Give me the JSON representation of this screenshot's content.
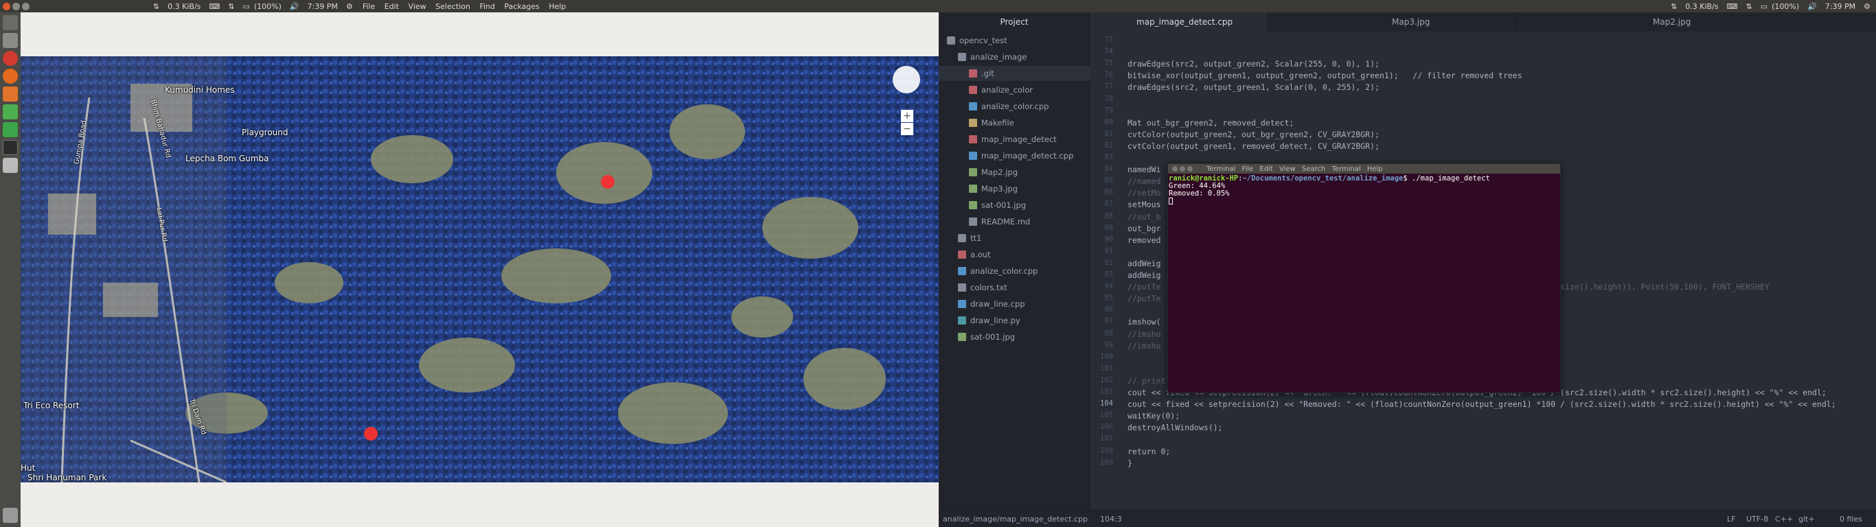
{
  "topbar_left": {
    "network": "0.3 KiB/s",
    "battery": "(100%)",
    "clock": "7:39 PM",
    "menus": [
      "File",
      "Edit",
      "View",
      "Selection",
      "Find",
      "Packages",
      "Help"
    ]
  },
  "topbar_right": {
    "network": "0.3 KiB/s",
    "battery": "(100%)",
    "clock": "7:39 PM"
  },
  "map": {
    "labels": [
      "Kumudini Homes",
      "Playground",
      "Lepcha Bom Gumba",
      "Tri Eco Resort",
      "Hut",
      "Shri Hanuman Park"
    ],
    "roads": [
      "Gumpa Road",
      "Bhim Bahadur Rd",
      "Lal Pur Rd",
      "Tri Dam Rd"
    ]
  },
  "project": {
    "title": "Project",
    "items": [
      {
        "label": "opencv_test",
        "type": "folder"
      },
      {
        "label": "analize_image",
        "type": "folder"
      },
      {
        "label": ".git",
        "type": "git"
      },
      {
        "label": "analize_color",
        "type": "bin"
      },
      {
        "label": "analize_color.cpp",
        "type": "cpp"
      },
      {
        "label": "Makefile",
        "type": "make"
      },
      {
        "label": "map_image_detect",
        "type": "bin"
      },
      {
        "label": "map_image_detect.cpp",
        "type": "cpp"
      },
      {
        "label": "Map2.jpg",
        "type": "img"
      },
      {
        "label": "Map3.jpg",
        "type": "img"
      },
      {
        "label": "sat-001.jpg",
        "type": "img"
      },
      {
        "label": "README.md",
        "type": "md"
      },
      {
        "label": "tt1",
        "type": "folder"
      },
      {
        "label": "a.out",
        "type": "bin"
      },
      {
        "label": "analize_color.cpp",
        "type": "cpp"
      },
      {
        "label": "colors.txt",
        "type": "txt"
      },
      {
        "label": "draw_line.cpp",
        "type": "cpp"
      },
      {
        "label": "draw_line.py",
        "type": "py"
      },
      {
        "label": "sat-001.jpg",
        "type": "img"
      }
    ]
  },
  "tabs": [
    "map_image_detect.cpp",
    "Map3.jpg",
    "Map2.jpg"
  ],
  "line_numbers": [
    "73",
    "74",
    "75",
    "76",
    "77",
    "78",
    "79",
    "80",
    "81",
    "82",
    "83",
    "84",
    "85",
    "86",
    "87",
    "88",
    "89",
    "90",
    "91",
    "92",
    "93",
    "94",
    "95",
    "96",
    "97",
    "98",
    "99",
    "100",
    "101",
    "102",
    "103",
    "104",
    "105",
    "106",
    "107",
    "108",
    "109"
  ],
  "code": [
    "",
    "",
    "drawEdges(src2, output_green2, Scalar(255, 0, 0), 1);",
    "bitwise_xor(output_green1, output_green2, output_green1);   // filter removed trees",
    "drawEdges(src2, output_green1, Scalar(0, 0, 255), 2);",
    "",
    "",
    "Mat out_bgr_green2, removed_detect;",
    "cvtColor(output_green2, out_bgr_green2, CV_GRAY2BGR);",
    "cvtColor(output_green1, removed_detect, CV_GRAY2BGR);",
    "",
    "namedWi",
    "//named",
    "//setMo",
    "setMous",
    "//out_b",
    "out_bgr",
    "removed",
    "",
    "addWeig",
    "addWeig",
    "//putTe                                                                     ).width * src2.size().height)), Point(50,100), FONT_HERSHEY",
    "//putTe                                                                     4);",
    "",
    "imshow(",
    "//imsho",
    "//imsho",
    "",
    "",
    "// print the percentage value",
    "cout << fixed << setprecision(2) << \"Green: \" << (float)countNonZero(output_green2) *100 / (src2.size().width * src2.size().height) << \"%\" << endl;",
    "cout << fixed << setprecision(2) << \"Removed: \" << (float)countNonZero(output_green1) *100 / (src2.size().width * src2.size().height) << \"%\" << endl;",
    "waitKey(0);",
    "destroyAllWindows();",
    "",
    "return 0;",
    "}"
  ],
  "terminal": {
    "title": "ranick@ranick-HP: ~/Documents/opencv_test/analize_image",
    "menus": [
      "Terminal",
      "File",
      "Edit",
      "View",
      "Search",
      "Terminal",
      "Help"
    ],
    "lines": [
      "ranick@ranick-HP:~/Documents/opencv_test/analize_image$ ./map_image_detect",
      "Green: 44.64%",
      "Removed: 0.05%",
      ""
    ]
  },
  "status": {
    "path": "analize_image/map_image_detect.cpp",
    "cursor": "104:3",
    "eol": "LF",
    "encoding": "UTF-8",
    "grammar": "C++",
    "git": "git+",
    "files": "0 files"
  }
}
